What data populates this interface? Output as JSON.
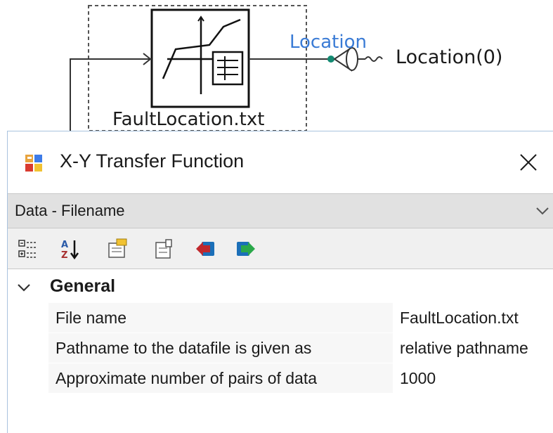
{
  "diagram": {
    "block_label": "FaultLocation.txt",
    "wire_label": "Location",
    "meter_label": "Location(0)"
  },
  "dialog": {
    "title": "X-Y Transfer Function",
    "selector_value": "Data - Filename",
    "toolbar": [
      {
        "name": "categorized-icon",
        "label": "Categorized"
      },
      {
        "name": "alphabetical-icon",
        "label": "Alphabetical"
      },
      {
        "name": "property-pages-icon",
        "label": "Property Pages"
      },
      {
        "name": "edit-page-icon",
        "label": "Edit"
      },
      {
        "name": "export-icon",
        "label": "Export"
      },
      {
        "name": "import-icon",
        "label": "Import"
      }
    ],
    "category": "General",
    "properties": [
      {
        "name": "File name",
        "value": "FaultLocation.txt"
      },
      {
        "name": "Pathname to the datafile is given as",
        "value": "relative pathname"
      },
      {
        "name": "Approximate number of pairs of data",
        "value": "1000"
      }
    ]
  },
  "colors": {
    "wire_label": "#3a7bd5",
    "accent_node": "#138a72",
    "selector_bg": "#e1e1e1"
  }
}
